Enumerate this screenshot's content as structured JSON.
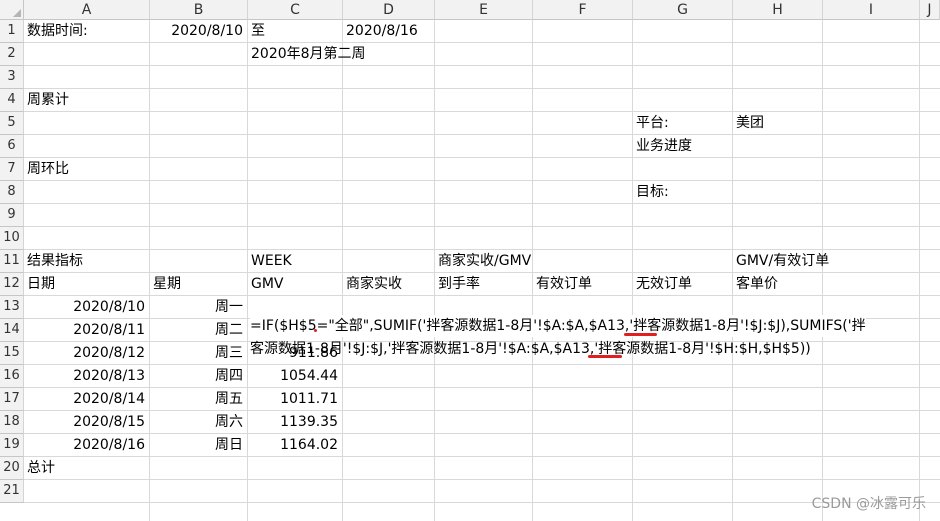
{
  "columns": [
    "A",
    "B",
    "C",
    "D",
    "E",
    "F",
    "G",
    "H",
    "I",
    "J"
  ],
  "rows": [
    "1",
    "2",
    "3",
    "4",
    "5",
    "6",
    "7",
    "8",
    "9",
    "10",
    "11",
    "12",
    "13",
    "14",
    "15",
    "16",
    "17",
    "18",
    "19",
    "20",
    "21"
  ],
  "cells": {
    "A1": "数据时间:",
    "B1": "2020/8/10",
    "C1": "至",
    "D1": "2020/8/16",
    "C2": "2020年8月第二周",
    "A4": "周累计",
    "G5": "平台:",
    "H5": "美团",
    "G6": "业务进度",
    "A7": "周环比",
    "G8": "目标:",
    "A11": "结果指标",
    "C11": "WEEK",
    "E11": "商家实收/GMV",
    "H11": "GMV/有效订单",
    "A12": "日期",
    "B12": "星期",
    "C12": "GMV",
    "D12": "商家实收",
    "E12": "到手率",
    "F12": "有效订单",
    "G12": "无效订单",
    "H12": "客单价",
    "A13": "2020/8/10",
    "B13": "周一",
    "A14": "2020/8/11",
    "B14": "周二",
    "A15": "2020/8/12",
    "B15": "周三",
    "C15": "911.86",
    "A16": "2020/8/13",
    "B16": "周四",
    "C16": "1054.44",
    "A17": "2020/8/14",
    "B17": "周五",
    "C17": "1011.71",
    "A18": "2020/8/15",
    "B18": "周六",
    "C18": "1139.35",
    "A19": "2020/8/16",
    "B19": "周日",
    "C19": "1164.02",
    "A20": "总计"
  },
  "formula": {
    "line1": "=IF($H$5=\"全部\",SUMIF('拌客源数据1-8月'!$A:$A,$A13,'拌客源数据1-8月'!$J:$J),SUMIFS('拌",
    "line2": "客源数据1-8月'!$J:$J,'拌客源数据1-8月'!$A:$A,$A13,'拌客源数据1-8月'!$H:$H,$H$5))"
  },
  "watermark": "CSDN @冰露可乐",
  "colors": {
    "annotation": "#e02020",
    "header_bg": "#f2f2f2",
    "grid": "#d9d9d9"
  }
}
